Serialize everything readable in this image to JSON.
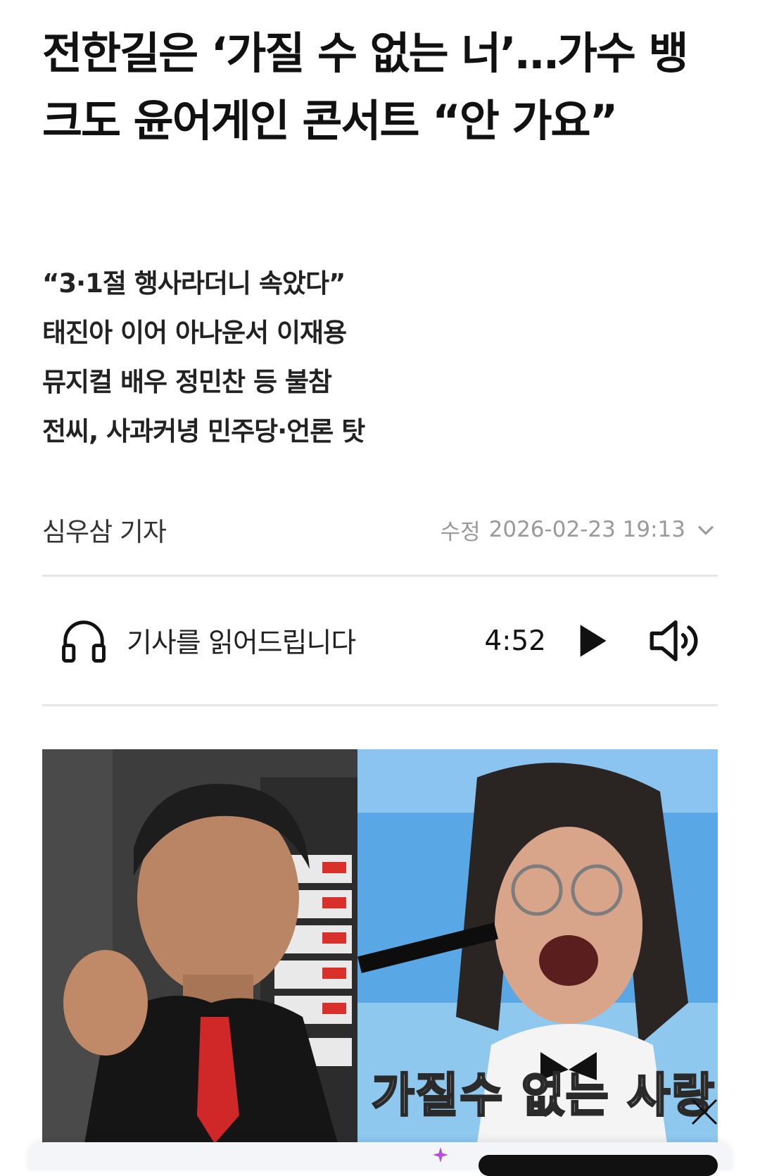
{
  "article": {
    "headline": "전한길은 ‘가질 수 없는 너’…가수 뱅크도 윤어게인 콘서트 “안 가요”",
    "subheadlines": [
      "“3·1절 행사라더니 속았다”",
      "태진아 이어 아나운서 이재용",
      "뮤지컬 배우 정민찬 등 불참",
      "전씨, 사과커녕 민주당·언론 탓"
    ],
    "author": "심우삼 기자",
    "modified_label": "수정",
    "modified_datetime": "2026-02-23 19:13"
  },
  "audio_player": {
    "label": "기사를 읽어드립니다",
    "duration": "4:52"
  },
  "photo": {
    "caption_overlay": "가질수 없는 사랑"
  },
  "icons": {
    "headphones": "headphones-icon",
    "play": "play-icon",
    "volume": "volume-icon",
    "chevron": "chevron-down-icon",
    "close": "close-icon",
    "sparkle": "sparkle-icon"
  }
}
